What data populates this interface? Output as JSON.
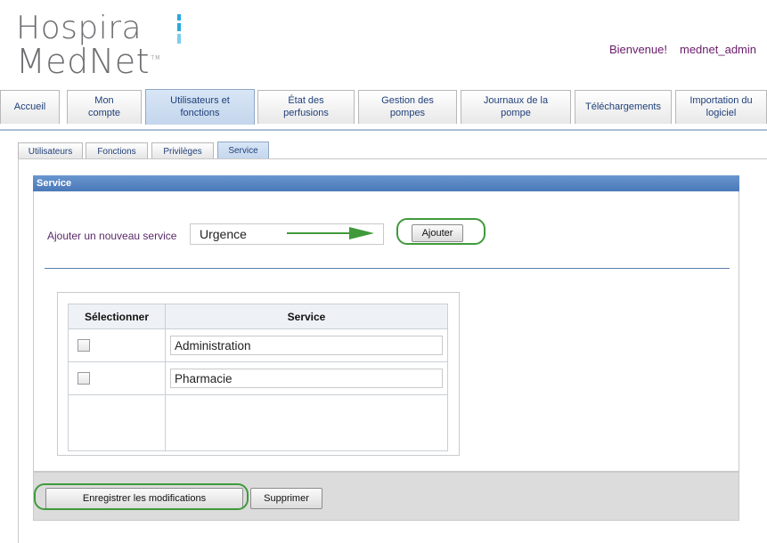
{
  "logo": {
    "line1": "Hospira",
    "line2": "MedNet",
    "tm": "TM"
  },
  "header": {
    "welcome": "Bienvenue!",
    "user": "mednet_admin"
  },
  "tabs": [
    {
      "label": "Accueil"
    },
    {
      "label": "Mon\ncompte"
    },
    {
      "label": "Utilisateurs et\nfonctions"
    },
    {
      "label": "État des\nperfusions"
    },
    {
      "label": "Gestion des\npompes"
    },
    {
      "label": "Journaux de la\npompe"
    },
    {
      "label": "Téléchargements"
    },
    {
      "label": "Importation du\nlogiciel"
    }
  ],
  "active_tab": "Utilisateurs et fonctions",
  "subtabs": [
    {
      "label": "Utilisateurs"
    },
    {
      "label": "Fonctions"
    },
    {
      "label": "Privilèges"
    },
    {
      "label": "Service"
    }
  ],
  "active_subtab": "Service",
  "panel": {
    "title": "Service",
    "add_label": "Ajouter un nouveau service",
    "add_value": "Urgence",
    "add_button": "Ajouter"
  },
  "table": {
    "headers": {
      "select": "Sélectionner",
      "service": "Service"
    },
    "rows": [
      {
        "checked": false,
        "service": "Administration"
      },
      {
        "checked": false,
        "service": "Pharmacie"
      }
    ]
  },
  "footer": {
    "save_button": "Enregistrer les modifications",
    "delete_button": "Supprimer"
  },
  "colors": {
    "logo_gray": "#6d6e71",
    "logo_blue": "#29a8e0",
    "panel_header": "#4a79b8",
    "highlight_green": "#3f9a3a",
    "welcome_text": "#6a1b6a"
  }
}
